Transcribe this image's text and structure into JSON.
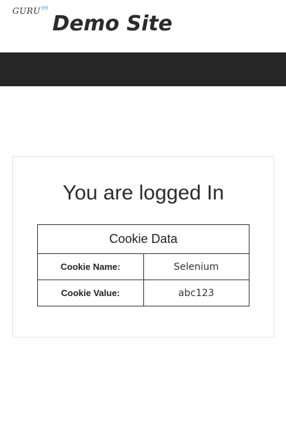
{
  "header": {
    "logo_text": "GURU",
    "logo_sup": "99",
    "site_title": "Demo Site"
  },
  "panel": {
    "heading": "You are logged In",
    "table": {
      "caption": "Cookie Data",
      "rows": [
        {
          "label": "Cookie Name:",
          "value": "Selenium"
        },
        {
          "label": "Cookie Value:",
          "value": "abc123"
        }
      ]
    }
  },
  "colors": {
    "navbar": "#262626",
    "logo_accent": "#2a8fc9"
  }
}
